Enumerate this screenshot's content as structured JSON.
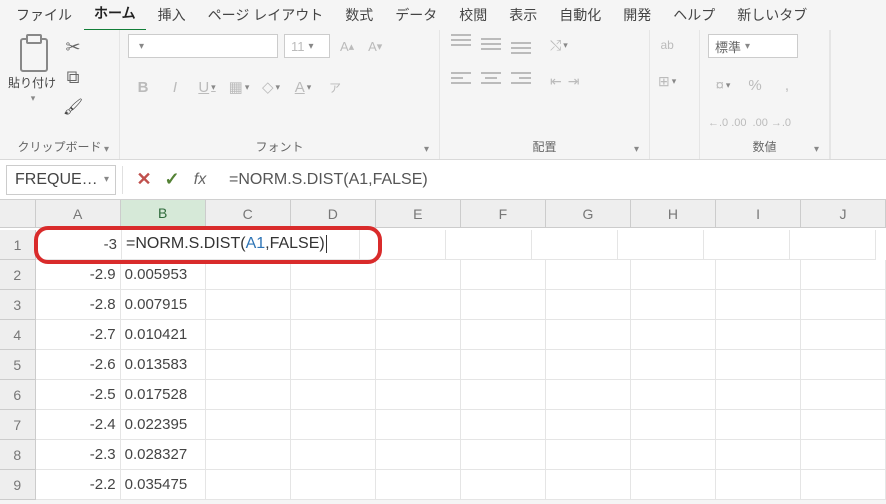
{
  "menu": {
    "items": [
      "ファイル",
      "ホーム",
      "挿入",
      "ページ レイアウト",
      "数式",
      "データ",
      "校閲",
      "表示",
      "自動化",
      "開発",
      "ヘルプ",
      "新しいタブ"
    ],
    "active_index": 1
  },
  "ribbon": {
    "clipboard": {
      "paste_label": "貼り付け",
      "group_label": "クリップボード"
    },
    "font": {
      "font_name": "",
      "font_size": "11",
      "increase": "A^",
      "decrease": "A˅",
      "bold": "B",
      "italic": "I",
      "underline": "U",
      "ruby": "ア",
      "group_label": "フォント"
    },
    "alignment": {
      "group_label": "配置",
      "wrap_label": "ab"
    },
    "number": {
      "format": "標準",
      "currency": "%",
      "comma": ",",
      "percent": "%",
      "inc_dec1": ".0",
      "inc_dec2": ".00",
      "group_label": "数値"
    }
  },
  "formula_bar": {
    "name_box": "FREQUE…",
    "formula": "=NORM.S.DIST(A1,FALSE)"
  },
  "columns": [
    "A",
    "B",
    "C",
    "D",
    "E",
    "F",
    "G",
    "H",
    "I",
    "J"
  ],
  "editing": {
    "prefix": "=NORM.S.DIST(",
    "ref": "A1",
    "suffix": ",FALSE)"
  },
  "rows": [
    {
      "n": 1,
      "a": "-3",
      "b": "",
      "editing": true
    },
    {
      "n": 2,
      "a": "-2.9",
      "b": "0.005953"
    },
    {
      "n": 3,
      "a": "-2.8",
      "b": "0.007915"
    },
    {
      "n": 4,
      "a": "-2.7",
      "b": "0.010421"
    },
    {
      "n": 5,
      "a": "-2.6",
      "b": "0.013583"
    },
    {
      "n": 6,
      "a": "-2.5",
      "b": "0.017528"
    },
    {
      "n": 7,
      "a": "-2.4",
      "b": "0.022395"
    },
    {
      "n": 8,
      "a": "-2.3",
      "b": "0.028327"
    },
    {
      "n": 9,
      "a": "-2.2",
      "b": "0.035475"
    }
  ]
}
